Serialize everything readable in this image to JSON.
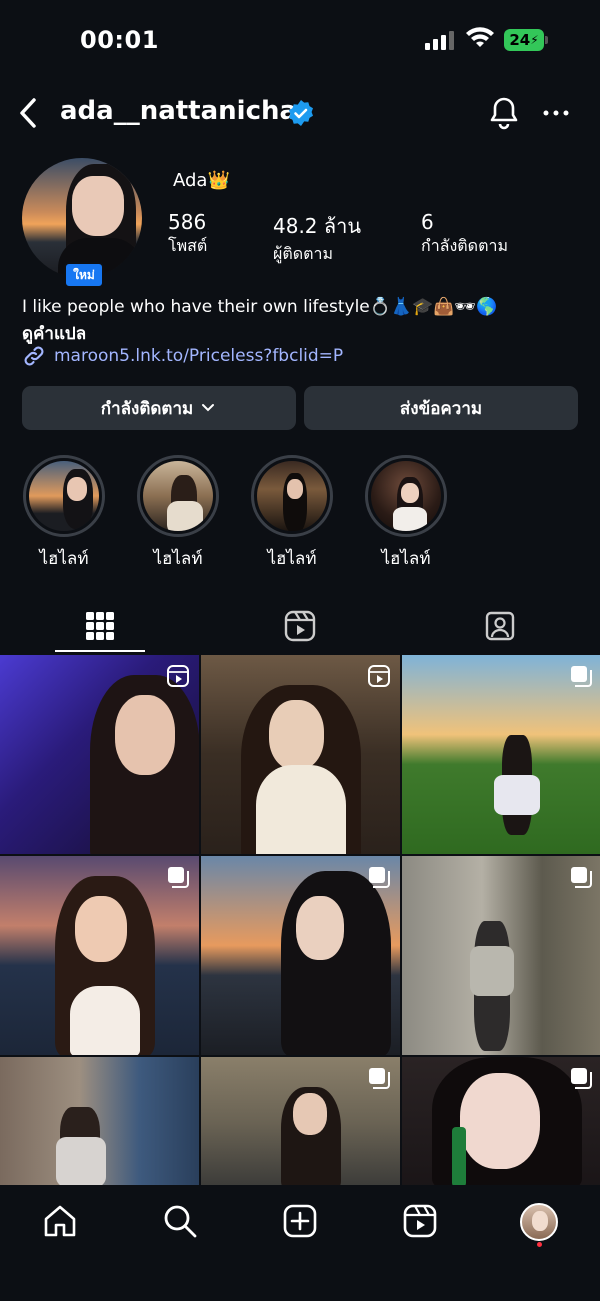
{
  "status_bar": {
    "time": "00:01",
    "battery": "24"
  },
  "header": {
    "username": "ada__nattanicha"
  },
  "profile": {
    "new_badge": "ใหม่",
    "display_name": "Ada👑",
    "stats": [
      {
        "value": "586",
        "label": "โพสต์"
      },
      {
        "value": "48.2 ล้าน",
        "label": "ผู้ติดตาม"
      },
      {
        "value": "6",
        "label": "กำลังติดตาม"
      }
    ],
    "bio": "I like people who have their own lifestyle💍👗🎓👜🕶🌎",
    "translate": "ดูคำแปล",
    "link": "maroon5.lnk.to/Priceless?fbclid=P"
  },
  "buttons": {
    "following": "กำลังติดตาม",
    "message": "ส่งข้อความ"
  },
  "highlights": [
    {
      "label": "ไฮไลท์"
    },
    {
      "label": "ไฮไลท์"
    },
    {
      "label": "ไฮไลท์"
    },
    {
      "label": "ไฮไลท์"
    }
  ],
  "colors": {
    "background": "#0c0f14",
    "button": "#2b3138",
    "link": "#a3b6ff",
    "verified": "#1d9bf0",
    "battery": "#33c759"
  }
}
